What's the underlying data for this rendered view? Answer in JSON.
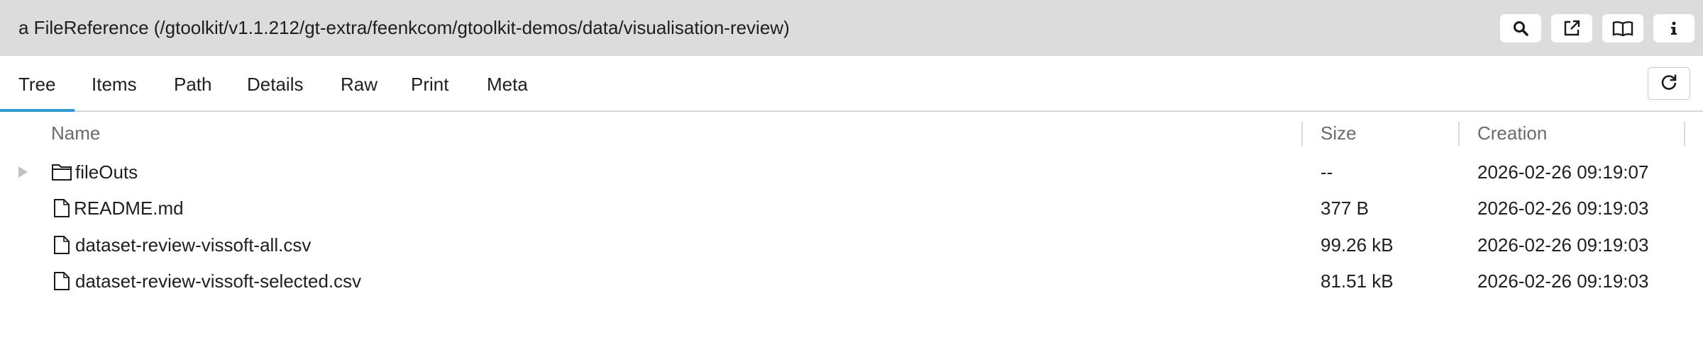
{
  "header": {
    "title": "a FileReference (/gtoolkit/v1.1.212/gt-extra/feenkcom/gtoolkit-demos/data/visualisation-review)",
    "buttons": [
      {
        "icon": "search-icon"
      },
      {
        "icon": "open-external-icon"
      },
      {
        "icon": "book-icon"
      },
      {
        "icon": "info-icon"
      }
    ]
  },
  "tabs": {
    "items": [
      {
        "label": "Tree",
        "active": true
      },
      {
        "label": "Items",
        "active": false
      },
      {
        "label": "Path",
        "active": false
      },
      {
        "label": "Details",
        "active": false
      },
      {
        "label": "Raw",
        "active": false
      },
      {
        "label": "Print",
        "active": false
      },
      {
        "label": "Meta",
        "active": false
      }
    ],
    "refresh_icon": "refresh-icon"
  },
  "table": {
    "columns": [
      "Name",
      "Size",
      "Creation"
    ],
    "rows": [
      {
        "name": "fileOuts",
        "type": "folder",
        "expandable": true,
        "size": "--",
        "creation": "2026-02-26 09:19:07"
      },
      {
        "name": "README.md",
        "type": "file",
        "expandable": false,
        "size": "377 B",
        "creation": "2026-02-26 09:19:03"
      },
      {
        "name": "dataset-review-vissoft-all.csv",
        "type": "file",
        "expandable": false,
        "size": "99.26 kB",
        "creation": "2026-02-26 09:19:03"
      },
      {
        "name": "dataset-review-vissoft-selected.csv",
        "type": "file",
        "expandable": false,
        "size": "81.51 kB",
        "creation": "2026-02-26 09:19:03"
      }
    ]
  },
  "colors": {
    "header_bg": "#dcdcdc",
    "active_tab_underline": "#2d9be0",
    "column_header_text": "#6b6b6b"
  }
}
